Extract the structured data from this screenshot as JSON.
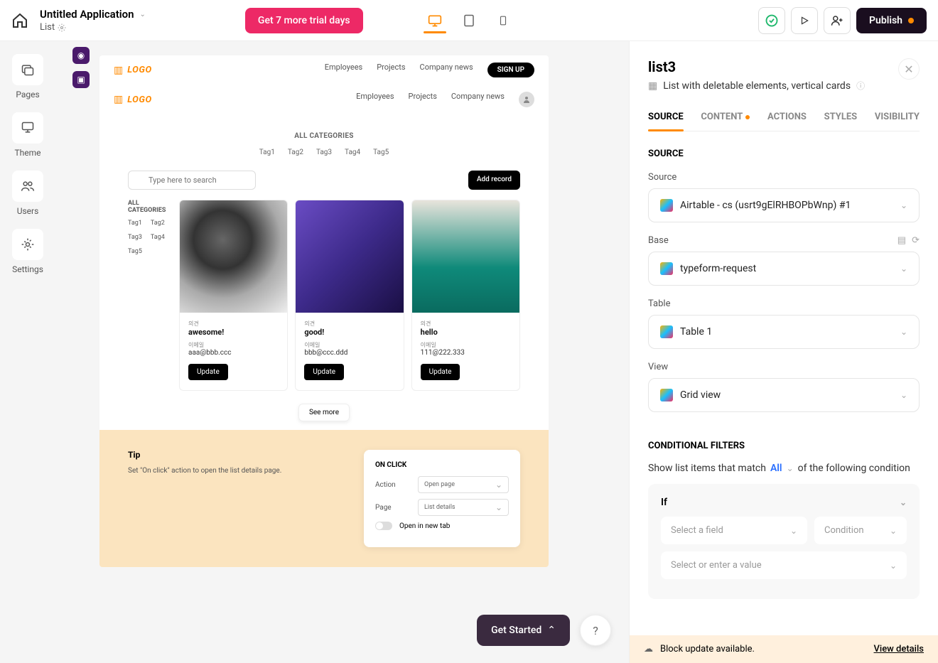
{
  "top": {
    "app_title": "Untitled Application",
    "app_sub": "List",
    "trial": "Get 7 more trial days",
    "publish": "Publish"
  },
  "rail": {
    "pages": "Pages",
    "theme": "Theme",
    "users": "Users",
    "settings": "Settings"
  },
  "canvas": {
    "logo": "LOGO",
    "nav": [
      "Employees",
      "Projects",
      "Company news"
    ],
    "signup": "SIGN UP",
    "all_categories": "ALL CATEGORIES",
    "tags": [
      "Tag1",
      "Tag2",
      "Tag3",
      "Tag4",
      "Tag5"
    ],
    "search_placeholder": "Type here to search",
    "add_record": "Add record",
    "side_h": "ALL CATEGORIES",
    "side_tags": [
      "Tag1",
      "Tag2",
      "Tag3",
      "Tag4",
      "Tag5"
    ],
    "cards": [
      {
        "l1": "의견",
        "v1": "awesome!",
        "l2": "이메일",
        "v2": "aaa@bbb.ccc",
        "btn": "Update"
      },
      {
        "l1": "의견",
        "v1": "good!",
        "l2": "이메일",
        "v2": "bbb@ccc.ddd",
        "btn": "Update"
      },
      {
        "l1": "의견",
        "v1": "hello",
        "l2": "이메일",
        "v2": "111@222.333",
        "btn": "Update"
      }
    ],
    "see_more": "See more",
    "tip": {
      "h": "Tip",
      "txt": "Set \"On click\" action to open the list details page.",
      "card_h": "ON CLICK",
      "action_lbl": "Action",
      "action_val": "Open page",
      "page_lbl": "Page",
      "page_val": "List details",
      "open_tab": "Open in new tab"
    }
  },
  "right": {
    "title": "list3",
    "subtitle": "List with deletable elements, vertical cards",
    "tabs": {
      "source": "SOURCE",
      "content": "CONTENT",
      "actions": "ACTIONS",
      "styles": "STYLES",
      "visibility": "VISIBILITY"
    },
    "sec_source": "SOURCE",
    "source_lbl": "Source",
    "source_val": "Airtable - cs (usrt9gElRHBOPbWnp) #1",
    "base_lbl": "Base",
    "base_val": "typeform-request",
    "table_lbl": "Table",
    "table_val": "Table 1",
    "view_lbl": "View",
    "view_val": "Grid view",
    "cond_h": "CONDITIONAL FILTERS",
    "cond_pre": "Show list items that match",
    "cond_all": "All",
    "cond_post": "of the following condition",
    "if": "If",
    "sel_field": "Select a field",
    "sel_cond": "Condition",
    "sel_val": "Select or enter a value",
    "banner": "Block update available.",
    "view_details": "View details"
  },
  "float": {
    "get_started": "Get Started"
  }
}
